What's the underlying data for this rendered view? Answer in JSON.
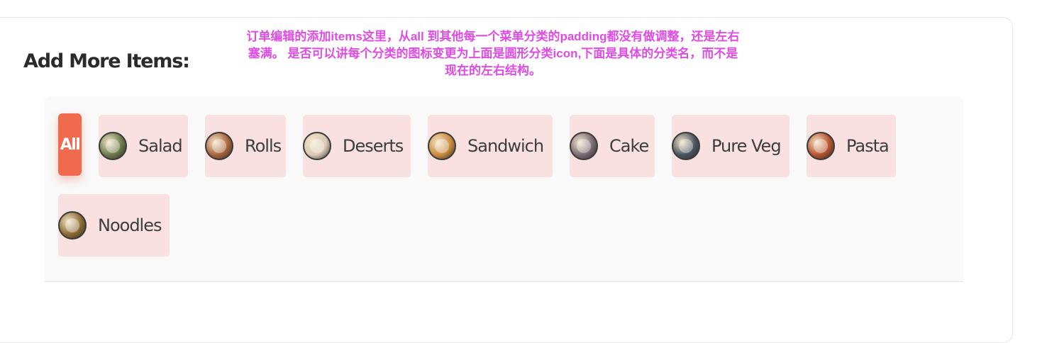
{
  "section_title": "Add More Items:",
  "annotation_note": "订单编辑的添加items这里，从all 到其他每一个菜单分类的padding都没有做调整，还是左右塞满。 是否可以讲每个分类的图标变更为上面是圆形分类icon,下面是具体的分类名，而不是现在的左右结构。",
  "colors": {
    "accent": "#f06a4e",
    "chip_background": "#f9e1e2",
    "annotation": "#e04be6"
  },
  "categories": {
    "all_label": "All",
    "items": [
      {
        "label": "Salad",
        "icon": "salad-icon",
        "color": "#6b7a4a"
      },
      {
        "label": "Rolls",
        "icon": "rolls-icon",
        "color": "#a8633a"
      },
      {
        "label": "Deserts",
        "icon": "desserts-icon",
        "color": "#d9c9b6"
      },
      {
        "label": "Sandwich",
        "icon": "sandwich-icon",
        "color": "#c98a3d"
      },
      {
        "label": "Cake",
        "icon": "cake-icon",
        "color": "#7a6a74"
      },
      {
        "label": "Pure Veg",
        "icon": "pure-veg-icon",
        "color": "#4a5560"
      },
      {
        "label": "Pasta",
        "icon": "pasta-icon",
        "color": "#b5522c"
      },
      {
        "label": "Noodles",
        "icon": "noodles-icon",
        "color": "#8a6b32"
      }
    ]
  }
}
